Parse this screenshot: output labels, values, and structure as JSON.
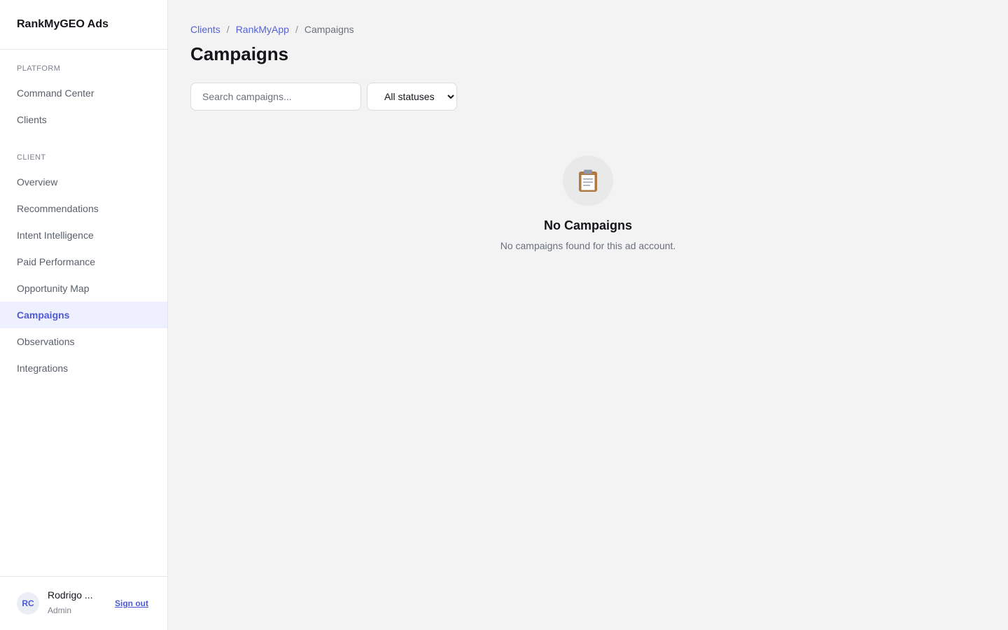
{
  "brand": "RankMyGEO Ads",
  "sidebar": {
    "sections": [
      {
        "label": "PLATFORM",
        "items": [
          {
            "label": "Command Center"
          },
          {
            "label": "Clients"
          }
        ]
      },
      {
        "label": "CLIENT",
        "items": [
          {
            "label": "Overview"
          },
          {
            "label": "Recommendations"
          },
          {
            "label": "Intent Intelligence"
          },
          {
            "label": "Paid Performance"
          },
          {
            "label": "Opportunity Map"
          },
          {
            "label": "Campaigns",
            "active": true
          },
          {
            "label": "Observations"
          },
          {
            "label": "Integrations"
          }
        ]
      }
    ]
  },
  "user": {
    "initials": "RC",
    "name": "Rodrigo ...",
    "role": "Admin",
    "signout_label": "Sign out"
  },
  "breadcrumb": {
    "items": [
      "Clients",
      "RankMyApp"
    ],
    "separator": "/",
    "current": "Campaigns"
  },
  "page": {
    "title": "Campaigns"
  },
  "filters": {
    "search_placeholder": "Search campaigns...",
    "status_selected": "All statuses"
  },
  "empty_state": {
    "icon": "clipboard-icon",
    "glyph": "📋",
    "title": "No Campaigns",
    "text": "No campaigns found for this ad account."
  },
  "colors": {
    "accent": "#4d5ad6",
    "active_bg": "#eef0fd",
    "page_bg": "#f3f3f3"
  }
}
